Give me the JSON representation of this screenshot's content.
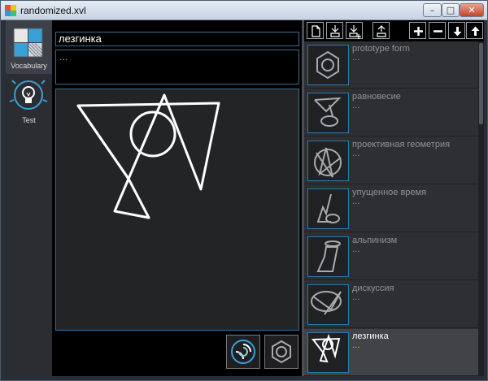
{
  "window": {
    "title": "randomized.xvl",
    "minimize": "–",
    "maximize": "□",
    "close": "✕"
  },
  "sidebar": {
    "items": [
      {
        "label": "Vocabulary",
        "icon": "vocabulary-icon",
        "active": true
      },
      {
        "label": "Test",
        "icon": "test-lightbulb-icon",
        "active": false
      }
    ]
  },
  "editor": {
    "word": "лезгинка",
    "description": "...",
    "buttons": [
      {
        "icon": "randomize-swirl-icon"
      },
      {
        "icon": "prototype-hexagon-icon"
      }
    ]
  },
  "toolbar": {
    "buttons": [
      {
        "icon": "new-file-icon"
      },
      {
        "icon": "import-icon"
      },
      {
        "icon": "import-add-icon"
      },
      {
        "icon": "export-icon"
      },
      {
        "icon": "add-icon"
      },
      {
        "icon": "remove-icon"
      },
      {
        "icon": "move-down-icon"
      },
      {
        "icon": "move-up-icon"
      }
    ]
  },
  "list": {
    "items": [
      {
        "title": "prototype form",
        "description": "...",
        "selected": false
      },
      {
        "title": "равновесие",
        "description": "...",
        "selected": false
      },
      {
        "title": "проективная геометрия",
        "description": "...",
        "selected": false
      },
      {
        "title": "упущенное время",
        "description": "...",
        "selected": false
      },
      {
        "title": "альпинизм",
        "description": "...",
        "selected": false
      },
      {
        "title": "дискуссия",
        "description": "...",
        "selected": false
      },
      {
        "title": "лезгинка",
        "description": "...",
        "selected": true
      }
    ]
  },
  "colors": {
    "accent": "#2f79a4",
    "selected_desc": "#d6cb3a",
    "background": "#000000"
  }
}
